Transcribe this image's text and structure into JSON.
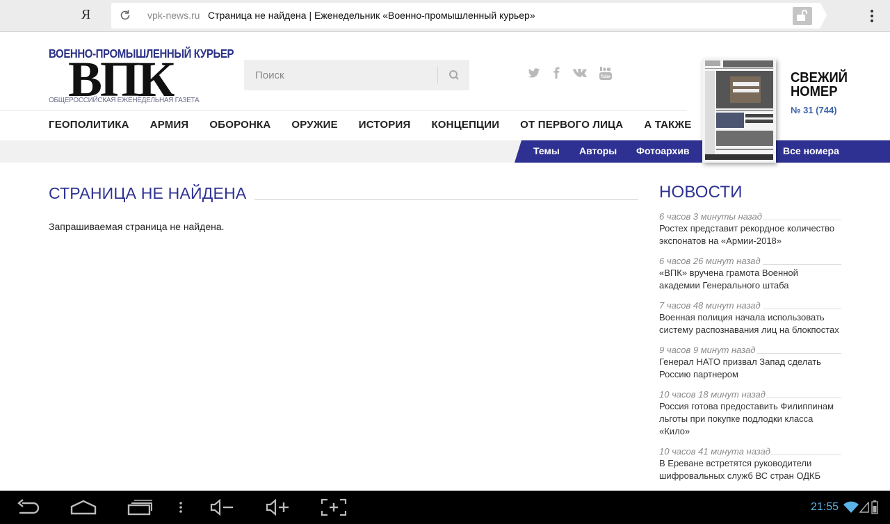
{
  "browser": {
    "ya_label": "Я",
    "url_domain": "vpk-news.ru",
    "url_title": "Страница не найдена | Еженедельник «Военно-промышленный курьер»"
  },
  "logo": {
    "top": "ВОЕННО-ПРОМЫШЛЕННЫЙ КУРЬЕР",
    "main": "ВПК",
    "bottom": "ОБЩЕРОССИЙСКАЯ ЕЖЕНЕДЕЛЬНАЯ ГАЗЕТА"
  },
  "search": {
    "placeholder": "Поиск"
  },
  "social": [
    "twitter-icon",
    "facebook-icon",
    "vk-icon",
    "youtube-icon"
  ],
  "nav": [
    "ГЕОПОЛИТИКА",
    "АРМИЯ",
    "ОБОРОНКА",
    "ОРУЖИЕ",
    "ИСТОРИЯ",
    "КОНЦЕПЦИИ",
    "ОТ ПЕРВОГО ЛИЦА",
    "А ТАКЖЕ"
  ],
  "subnav": {
    "themes": "Темы",
    "authors": "Авторы",
    "photo": "Фотоархив",
    "all_issues": "Все номера"
  },
  "issue": {
    "title_line1": "СВЕЖИЙ",
    "title_line2": "НОМЕР",
    "number": "№ 31 (744)"
  },
  "main": {
    "title": "СТРАНИЦА НЕ НАЙДЕНА",
    "text": "Запрашиваемая страница не найдена."
  },
  "news": {
    "title": "НОВОСТИ",
    "items": [
      {
        "time": "6 часов 3 минуты назад",
        "text": "Ростех представит рекордное количество экспонатов на «Армии-2018»"
      },
      {
        "time": "6 часов 26 минут назад",
        "text": "«ВПК» вручена грамота Военной академии Генерального штаба"
      },
      {
        "time": "7 часов 48 минут назад",
        "text": "Военная полиция начала использовать систему распознавания лиц на блокпостах"
      },
      {
        "time": "9 часов 9 минут назад",
        "text": "Генерал НАТО призвал Запад сделать Россию партнером"
      },
      {
        "time": "10 часов 18 минут назад",
        "text": "Россия готова предоставить Филиппинам льготы при покупке подлодки класса «Кило»"
      },
      {
        "time": "10 часов 41 минута назад",
        "text": "В Ереване встретятся руководители шифровальных служб ВС стран ОДКБ"
      }
    ]
  },
  "system": {
    "clock": "21:55"
  },
  "colors": {
    "brand": "#2e3192",
    "link": "#3b64a8",
    "clock": "#5ab3e6"
  }
}
